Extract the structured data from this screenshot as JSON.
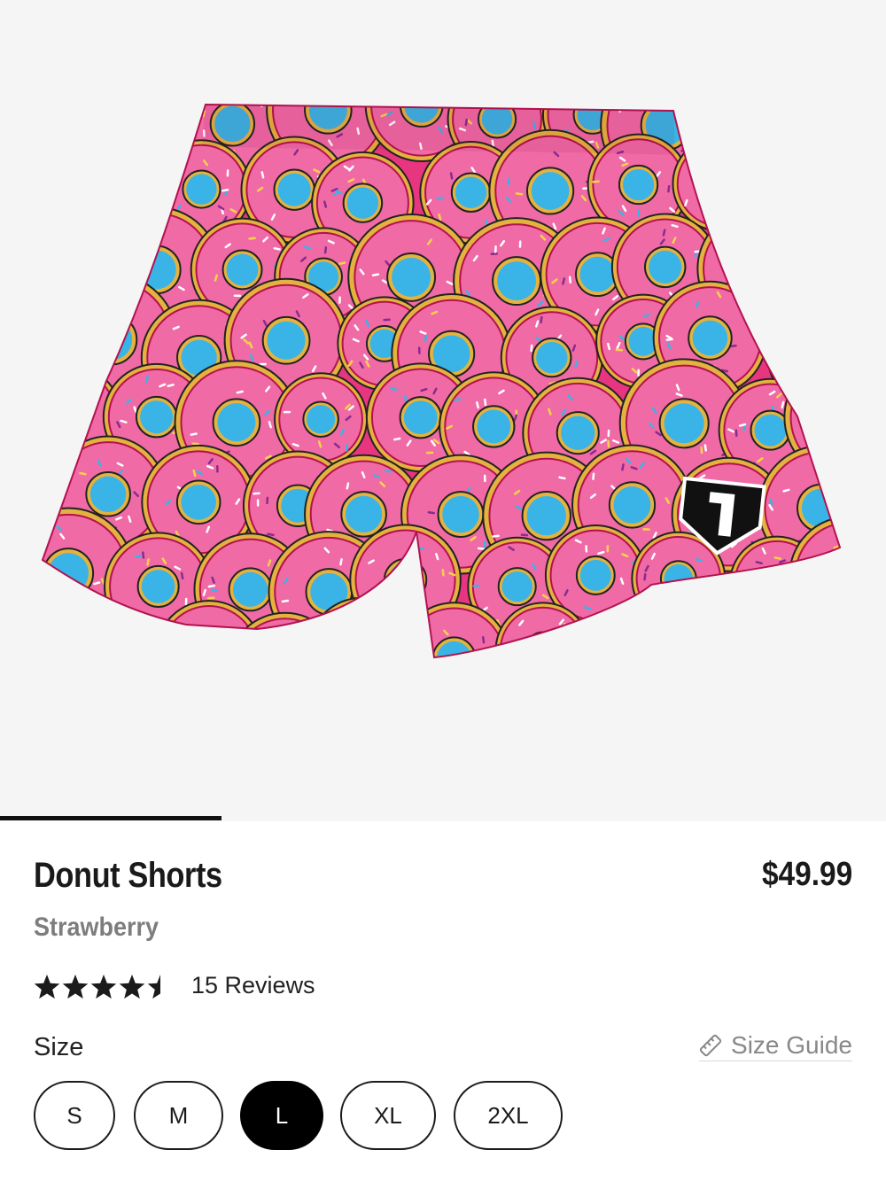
{
  "product": {
    "title": "Donut Shorts",
    "price": "$49.99",
    "color": "Strawberry",
    "rating": 4.5,
    "rating_max": 5,
    "reviews_label": "15 Reviews",
    "image_alt_icon": "donut-shorts-product-image"
  },
  "size": {
    "label": "Size",
    "guide_label": "Size Guide",
    "options": [
      "S",
      "M",
      "L",
      "XL",
      "2XL"
    ],
    "selected": "L"
  },
  "colors": {
    "gallery_bg": "#f5f5f5",
    "shorts_pink": "#e8357f",
    "donut_glaze": "#f06aa6",
    "donut_hole": "#3ab4e6",
    "text_primary": "#1a1a1a",
    "text_secondary": "#7d7d7d",
    "selected_bg": "#000000"
  },
  "gallery": {
    "current_slide": 1,
    "total_slides": 4
  }
}
